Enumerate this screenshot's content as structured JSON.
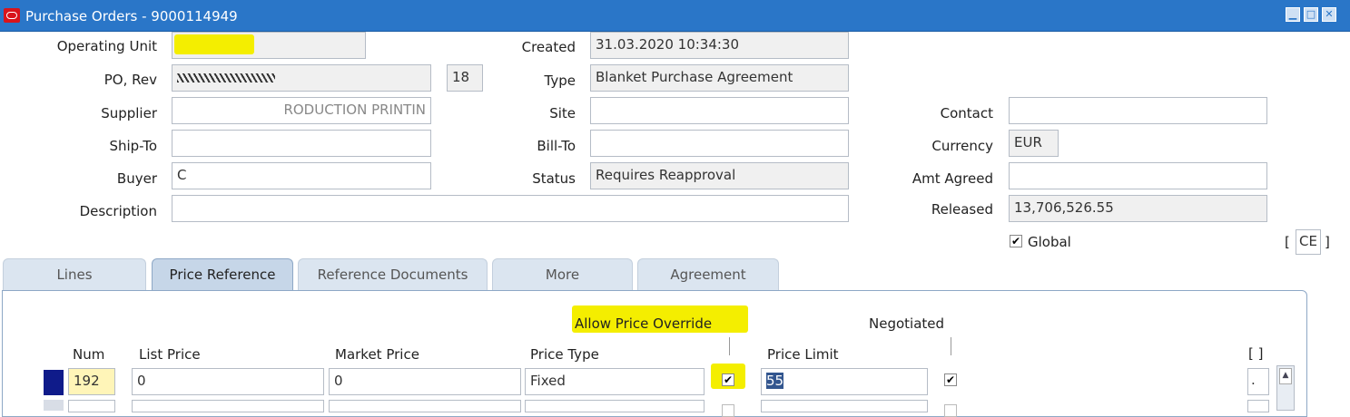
{
  "window": {
    "title": "Purchase Orders - 9000114949"
  },
  "header": {
    "operating_unit_label": "Operating Unit",
    "po_rev_label": "PO, Rev",
    "po_rev_value": "18",
    "supplier_label": "Supplier",
    "supplier_value": "RODUCTION PRINTIN",
    "ship_to_label": "Ship-To",
    "buyer_label": "Buyer",
    "buyer_value": "C",
    "description_label": "Description",
    "created_label": "Created",
    "created_value": "31.03.2020 10:34:30",
    "type_label": "Type",
    "type_value": "Blanket Purchase Agreement",
    "site_label": "Site",
    "bill_to_label": "Bill-To",
    "status_label": "Status",
    "status_value": "Requires Reapproval",
    "contact_label": "Contact",
    "currency_label": "Currency",
    "currency_value": "EUR",
    "amt_agreed_label": "Amt Agreed",
    "released_label": "Released",
    "released_value": "13,706,526.55",
    "global_label": "Global",
    "global_checked": true,
    "ce_value": "CE"
  },
  "tabs": [
    {
      "label": "Lines"
    },
    {
      "label": "Price Reference"
    },
    {
      "label": "Reference Documents"
    },
    {
      "label": "More"
    },
    {
      "label": "Agreement"
    }
  ],
  "lines": {
    "headers": {
      "num": "Num",
      "list_price": "List Price",
      "market_price": "Market Price",
      "price_type": "Price Type",
      "allow_price_override": "Allow Price Override",
      "price_limit": "Price Limit",
      "negotiated": "Negotiated",
      "bracket": "[ ]"
    },
    "rows": [
      {
        "num": "192",
        "list_price": "0",
        "market_price": "0",
        "price_type": "Fixed",
        "allow_price_override": true,
        "price_limit": "55",
        "negotiated": true
      }
    ]
  }
}
